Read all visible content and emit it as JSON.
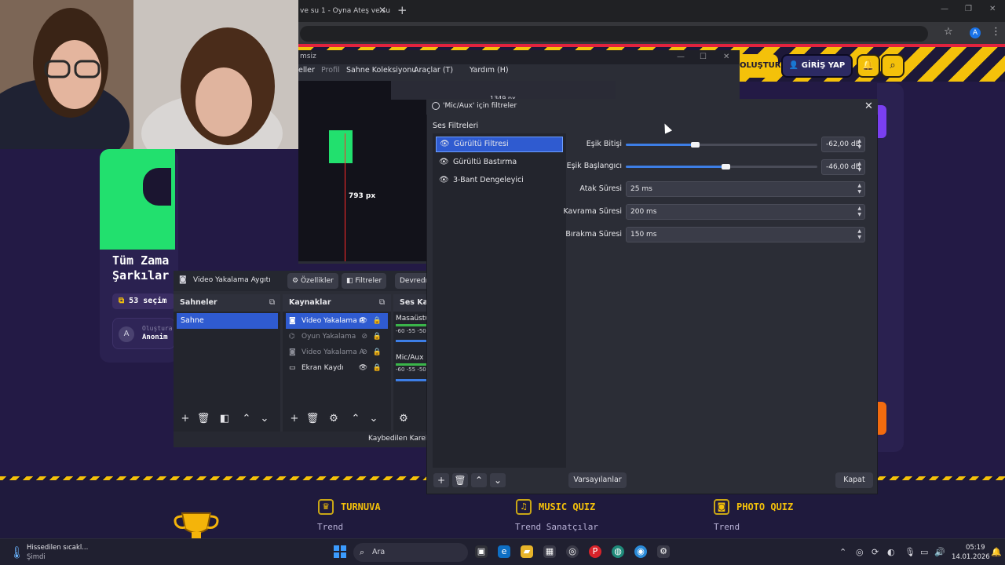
{
  "browser": {
    "tab_title": "ve su 1 - Oyna Ateş ve su",
    "tab_close": "✕",
    "new_tab": "+",
    "profile_initial": "A"
  },
  "site": {
    "create_button": "OLUŞTUR",
    "login_button": "GİRİŞ YAP",
    "card": {
      "title": "Tüm Zama\nŞarkılar",
      "selection_count": "53 seçim",
      "author_label": "Oluştura",
      "author_name": "Anonim",
      "author_initial": "A"
    },
    "footer": {
      "columns": [
        {
          "heading": "TURNUVA",
          "links": [
            "Trend"
          ]
        },
        {
          "heading": "MUSIC QUIZ",
          "links": [
            "Trend Sanatçılar"
          ]
        },
        {
          "heading": "PHOTO QUIZ",
          "links": [
            "Trend"
          ]
        }
      ]
    }
  },
  "obs": {
    "title_partial": "msiz",
    "menu": [
      "eller",
      "Profil",
      "Sahne Koleksiyonu",
      "Araçlar (T)",
      "Yardım (H)"
    ],
    "preview_px": "793 px",
    "preview_px_top": "1349 px",
    "source_bar": {
      "name": "Video Yakalama Aygıtı",
      "properties": "Özellikler",
      "filters": "Filtreler",
      "deactivate": "Devredışı"
    },
    "scenes": {
      "title": "Sahneler",
      "items": [
        "Sahne"
      ]
    },
    "sources": {
      "title": "Kaynaklar",
      "items": [
        "Video Yakalama A",
        "Oyun Yakalama",
        "Video Yakalama A",
        "Ekran Kaydı"
      ]
    },
    "mixer": {
      "title": "Ses Karı",
      "channels": [
        "Masaüstü",
        "Mic/Aux"
      ],
      "ticks": "-60 -55 -50"
    },
    "status": "Kaybedilen Kareler"
  },
  "filters_dialog": {
    "title": "'Mic/Aux' için filtreler",
    "section": "Ses Filtreleri",
    "items": [
      "Gürültü Filtresi",
      "Gürültü Bastırma",
      "3-Bant Dengeleyici"
    ],
    "selected_index": 0,
    "props": {
      "close_threshold": {
        "label": "Eşik Bitişi",
        "value": "-62,00 dB",
        "fraction": 0.36
      },
      "open_threshold": {
        "label": "Eşik Başlangıcı",
        "value": "-46,00 dB",
        "fraction": 0.52
      },
      "attack": {
        "label": "Atak Süresi",
        "value": "25 ms"
      },
      "hold": {
        "label": "Kavrama Süresi",
        "value": "200 ms"
      },
      "release": {
        "label": "Bırakma Süresi",
        "value": "150 ms"
      }
    },
    "defaults_button": "Varsayılanlar",
    "close_button": "Kapat"
  },
  "taskbar": {
    "weather_line1": "Hissedilen sıcakl...",
    "weather_line2": "Şimdi",
    "search_placeholder": "Ara",
    "time": "05:19",
    "date": "14.01.2026"
  },
  "colors": {
    "accent_yellow": "#f4c10a",
    "obs_select_blue": "#2f5bd0",
    "spotify_green": "#22e06e"
  }
}
